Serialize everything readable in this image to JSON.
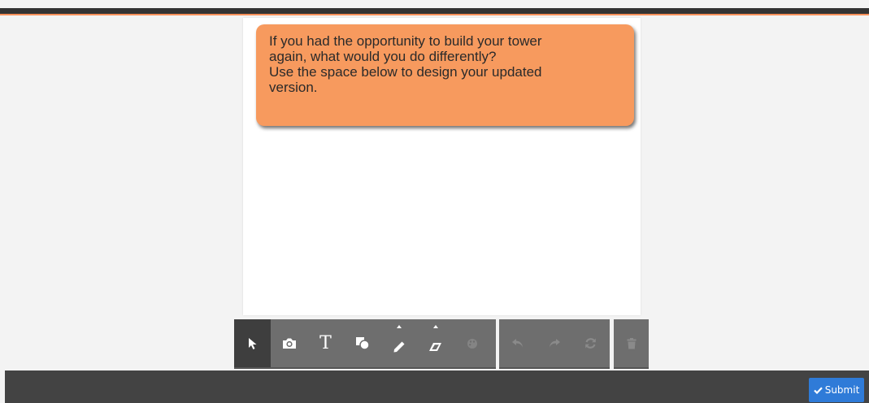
{
  "prompt": {
    "lines": [
      "If you had the opportunity to build your tower",
      "again, what would you do differently?",
      "Use the space below to design your updated",
      "version."
    ]
  },
  "toolbar": {
    "tools": [
      {
        "id": "select",
        "icon": "cursor-arrow-icon",
        "active": true
      },
      {
        "id": "camera",
        "icon": "camera-icon"
      },
      {
        "id": "text",
        "icon": "text-icon",
        "glyph": "T"
      },
      {
        "id": "shapes",
        "icon": "shapes-icon"
      },
      {
        "id": "pencil",
        "icon": "pencil-icon",
        "has_menu": true
      },
      {
        "id": "eraser",
        "icon": "eraser-icon",
        "has_menu": true
      },
      {
        "id": "color",
        "icon": "palette-icon",
        "disabled": true
      }
    ],
    "history": [
      {
        "id": "undo",
        "icon": "undo-icon",
        "disabled": true
      },
      {
        "id": "redo",
        "icon": "redo-icon",
        "disabled": true
      },
      {
        "id": "reset",
        "icon": "refresh-icon",
        "disabled": true
      }
    ],
    "trash": {
      "id": "delete",
      "icon": "trash-icon",
      "disabled": true
    }
  },
  "submit": {
    "label": "Submit",
    "icon": "check-icon"
  },
  "colors": {
    "accent": "#f6905a",
    "prompt_bg": "#f79a5e",
    "toolbar_bg": "#6e6e6e",
    "toolbar_active": "#3e3e3e",
    "bottom_bar": "#434343",
    "submit_bg": "#2f7bd8"
  }
}
